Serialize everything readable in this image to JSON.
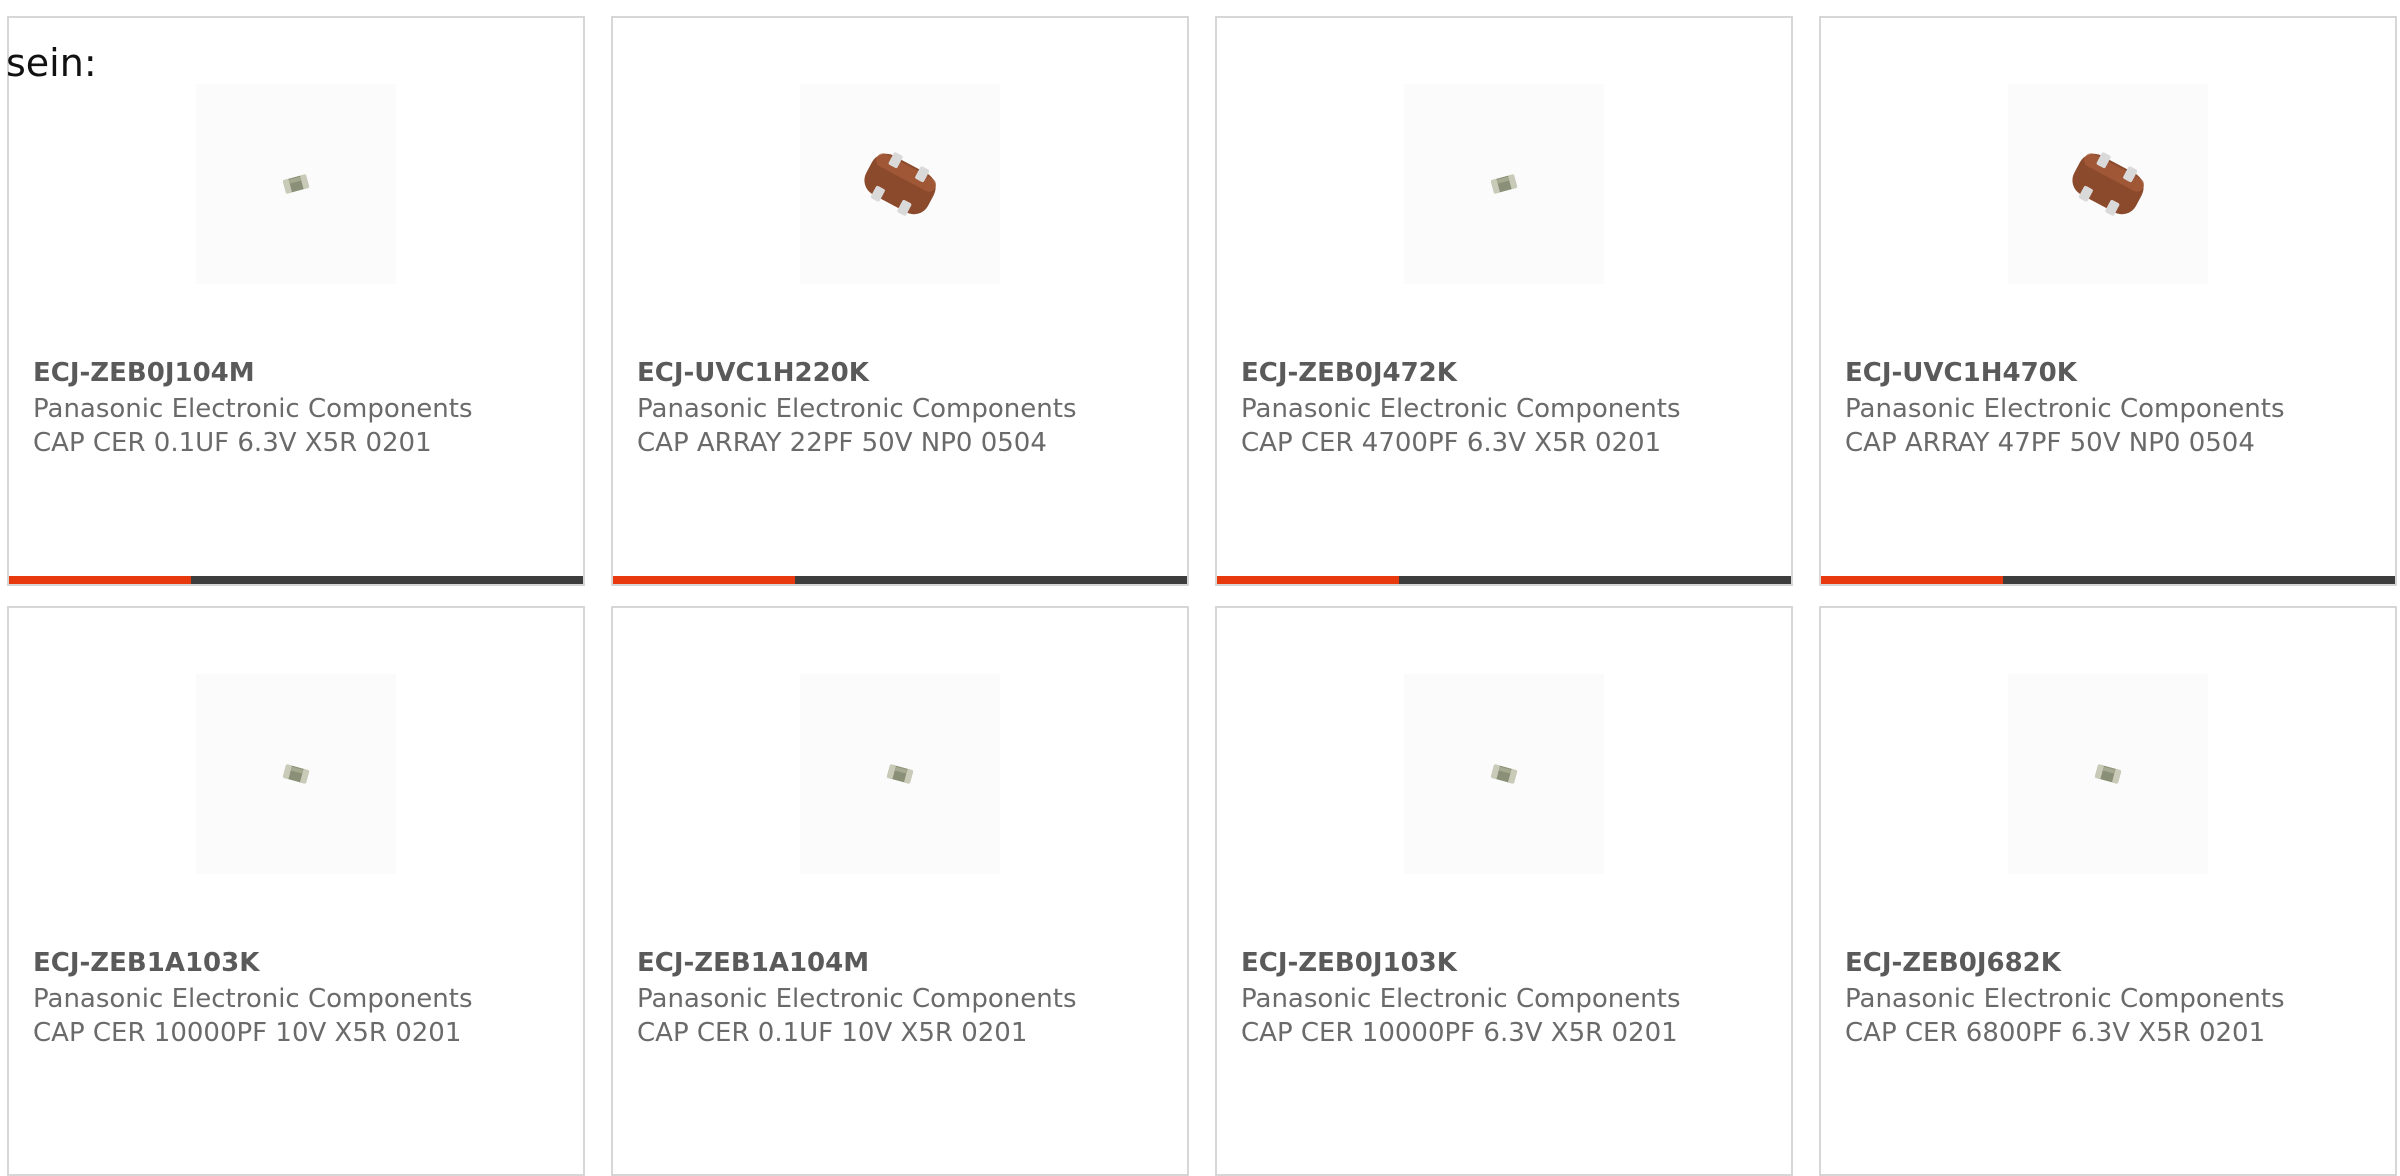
{
  "heading": "sein:",
  "colors": {
    "accent": "#e8380d",
    "bar": "#3d3d3d",
    "border": "#d6d6d6",
    "part_text": "#5a5a5a",
    "body_text": "#6a6a6a"
  },
  "products": [
    {
      "part": "ECJ-ZEB0J104M",
      "manufacturer": "Panasonic Electronic Components",
      "description": "CAP CER 0.1UF 6.3V X5R 0201",
      "image": "small-chip-capacitor-icon"
    },
    {
      "part": "ECJ-UVC1H220K",
      "manufacturer": "Panasonic Electronic Components",
      "description": "CAP ARRAY 22PF 50V NP0 0504",
      "image": "capacitor-array-icon"
    },
    {
      "part": "ECJ-ZEB0J472K",
      "manufacturer": "Panasonic Electronic Components",
      "description": "CAP CER 4700PF 6.3V X5R 0201",
      "image": "small-chip-capacitor-icon"
    },
    {
      "part": "ECJ-UVC1H470K",
      "manufacturer": "Panasonic Electronic Components",
      "description": "CAP ARRAY 47PF 50V NP0 0504",
      "image": "capacitor-array-icon"
    },
    {
      "part": "ECJ-ZEB1A103K",
      "manufacturer": "Panasonic Electronic Components",
      "description": "CAP CER 10000PF 10V X5R 0201",
      "image": "small-chip-capacitor-icon"
    },
    {
      "part": "ECJ-ZEB1A104M",
      "manufacturer": "Panasonic Electronic Components",
      "description": "CAP CER 0.1UF 10V X5R 0201",
      "image": "small-chip-capacitor-icon"
    },
    {
      "part": "ECJ-ZEB0J103K",
      "manufacturer": "Panasonic Electronic Components",
      "description": "CAP CER 10000PF 6.3V X5R 0201",
      "image": "small-chip-capacitor-icon"
    },
    {
      "part": "ECJ-ZEB0J682K",
      "manufacturer": "Panasonic Electronic Components",
      "description": "CAP CER 6800PF 6.3V X5R 0201",
      "image": "small-chip-capacitor-icon"
    }
  ]
}
